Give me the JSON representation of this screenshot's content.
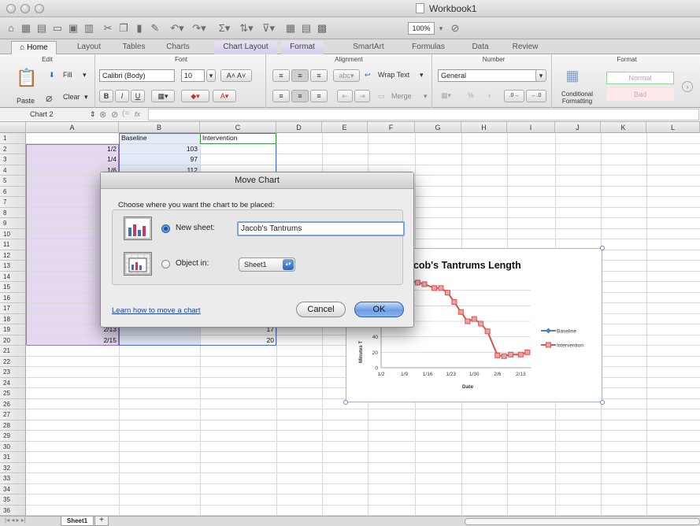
{
  "window": {
    "title": "Workbook1"
  },
  "toolbar": {
    "zoom": "100%"
  },
  "tabs": [
    "Home",
    "Layout",
    "Tables",
    "Charts",
    "Chart Layout",
    "Format",
    "SmartArt",
    "Formulas",
    "Data",
    "Review"
  ],
  "ribbon": {
    "groups": {
      "edit": "Edit",
      "font": "Font",
      "alignment": "Alignment",
      "number": "Number",
      "format": "Format"
    },
    "paste": "Paste",
    "fill": "Fill",
    "clear": "Clear",
    "font_name": "Calibri (Body)",
    "font_size": "10",
    "wrap_text": "Wrap Text",
    "merge": "Merge",
    "number_format": "General",
    "conditional_formatting_line1": "Conditional",
    "conditional_formatting_line2": "Formatting",
    "style_normal": "Normal",
    "style_bad": "Bad",
    "abc": "abc"
  },
  "formula_bar": {
    "name_box": "Chart 2",
    "fx": "fx"
  },
  "columns": [
    "A",
    "B",
    "C",
    "D",
    "E",
    "F",
    "G",
    "H",
    "I",
    "J",
    "K",
    "L"
  ],
  "rows": [
    "1",
    "2",
    "3",
    "4",
    "5",
    "6",
    "7",
    "8",
    "9",
    "10",
    "11",
    "12",
    "13",
    "14",
    "15",
    "16",
    "17",
    "18",
    "19",
    "20",
    "21",
    "22",
    "23",
    "24",
    "25",
    "26",
    "27",
    "28",
    "29",
    "30",
    "31",
    "32",
    "33",
    "34",
    "35",
    "36"
  ],
  "cells": {
    "b1": "Baseline",
    "c1": "Intervention",
    "a2": "1/2",
    "b2": "103",
    "a3": "1/4",
    "b3": "97",
    "a4": "1/6",
    "b4": "112",
    "a19": "2/13",
    "c19": "17",
    "a20": "2/15",
    "c20": "20"
  },
  "chart": {
    "title_visible": "acob's Tantrums Length",
    "ylabel_visible": "Minutes T",
    "xlabel": "Date",
    "y_ticks_visible": [
      "40",
      "20",
      "0"
    ],
    "x_ticks": [
      "1/2",
      "1/9",
      "1/16",
      "1/23",
      "1/30",
      "2/6",
      "2/13"
    ],
    "legend": [
      "Baseline",
      "Intervention"
    ],
    "colors": {
      "baseline": "#4f81bd",
      "intervention": "#d9534f",
      "intervention_fill": "#f2a0a0"
    }
  },
  "chart_data": {
    "type": "line",
    "title": "Jacob's Tantrums Length",
    "xlabel": "Date",
    "ylabel": "Minutes T",
    "x_ticks": [
      "1/2",
      "1/9",
      "1/16",
      "1/23",
      "1/30",
      "2/6",
      "2/13"
    ],
    "series": [
      {
        "name": "Baseline",
        "x": [
          "1/11",
          "1/13"
        ],
        "values": [
          112,
          110
        ]
      },
      {
        "name": "Intervention",
        "x": [
          "1/13",
          "1/15",
          "1/18",
          "1/20",
          "1/22",
          "1/24",
          "1/26",
          "1/28",
          "1/30",
          "2/1",
          "2/3",
          "2/6",
          "2/8",
          "2/10",
          "2/13",
          "2/15"
        ],
        "values": [
          110,
          108,
          103,
          103,
          97,
          85,
          72,
          60,
          63,
          57,
          47,
          16,
          15,
          17,
          17,
          20
        ]
      }
    ],
    "ylim": [
      0,
      115
    ],
    "legend_position": "right"
  },
  "sheet_tabs": {
    "sheet1": "Sheet1",
    "add": "+"
  },
  "dialog": {
    "title": "Move Chart",
    "prompt": "Choose where you want the chart to be placed:",
    "new_sheet_label": "New sheet:",
    "new_sheet_value": "Jacob's Tantrums",
    "object_in_label": "Object in:",
    "object_in_value": "Sheet1",
    "learn_link": "Learn how to move a chart",
    "cancel": "Cancel",
    "ok": "OK"
  }
}
